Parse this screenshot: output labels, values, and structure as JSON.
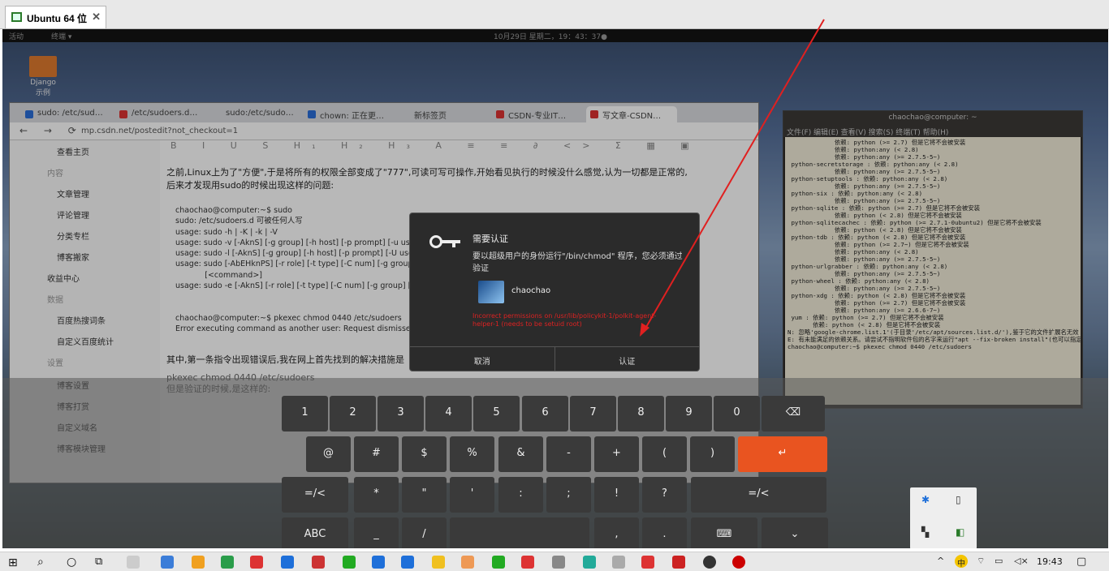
{
  "vm_tab": {
    "label": "Ubuntu 64 位",
    "close": "✕"
  },
  "topbar": {
    "activities": "活动",
    "terminal_menu": "终端 ▾",
    "datetime": "10月29日 星期二，19：43：37●"
  },
  "desktop": {
    "icon_label": "Django 示例"
  },
  "browser": {
    "tabs": [
      "sudo: /etc/sud…",
      "/etc/sudoers.d…",
      "sudo:/etc/sudo…",
      "chown: 正在更…",
      "新标签页",
      "CSDN-专业IT…",
      "写文章-CSDN…"
    ],
    "nav": "← → ⟳",
    "url": "mp.csdn.net/postedit?not_checkout=1",
    "sidebar": [
      "查看主页",
      "内容",
      "文章管理",
      "评论管理",
      "分类专栏",
      "博客搬家",
      "收益中心",
      "数据",
      "百度热搜词条",
      "自定义百度统计",
      "设置",
      "博客设置",
      "博客打赏",
      "自定义域名",
      "博客模块管理"
    ],
    "toolbar": "B I U S H₁ H₂ H₃ A ≡ ≡ ∂ <> Σ ▦ ▣ ⇥ ≡ ↶ ↷",
    "intro": "之前,Linux上为了\"方便\",于是将所有的权限全部变成了\"777\",可读可写可操作,开始看见执行的时候没什么感觉,认为一切都是正常的,后来才发现用sudo的时候出现这样的问题:",
    "code": "chaochao@computer:~$ sudo\nsudo: /etc/sudoers.d 可被任何人写\nusage: sudo -h | -K | -k | -V\nusage: sudo -v [-AknS] [-g group] [-h host] [-p prompt] [-u user]\nusage: sudo -l [-AknS] [-g group] [-h host] [-p prompt] [-U user]\nusage: sudo [-AbEHknPS] [-r role] [-t type] [-C num] [-g group]\n            [<command>]\nusage: sudo -e [-AknS] [-r role] [-t type] [-C num] [-g group] [-h h\n\n\nchaochao@computer:~$ pkexec chmod 0440 /etc/sudoers\nError executing command as another user: Request dismissed",
    "para2": "其中,第一条指令出现错误后,我在网上首先找到的解决措施是",
    "para3": "pkexec chmod 0440 /etc/sudoers\n但是验证的时候,是这样的:"
  },
  "terminal": {
    "title": "chaochao@computer: ~",
    "menu": "文件(F)  编辑(E)  查看(V)  搜索(S)  终端(T)  帮助(H)",
    "text": "             依赖: python (>= 2.7) 但是它将不会被安装\n             依赖: python:any (< 2.8)\n             依赖: python:any (>= 2.7.5-5~)\n python-secretstorage : 依赖: python:any (< 2.8)\n             依赖: python:any (>= 2.7.5-5~)\n python-setuptools : 依赖: python:any (< 2.8)\n             依赖: python:any (>= 2.7.5-5~)\n python-six : 依赖: python:any (< 2.8)\n             依赖: python:any (>= 2.7.5-5~)\n python-sqlite : 依赖: python (>= 2.7) 但是它将不会被安装\n             依赖: python (< 2.8) 但是它将不会被安装\n python-sqlitecachec : 依赖: python (>= 2.7.1-0ubuntu2) 但是它将不会被安装\n             依赖: python (< 2.8) 但是它将不会被安装\n python-tdb : 依赖: python (< 2.8) 但是它将不会被安装\n             依赖: python (>= 2.7~) 但是它将不会被安装\n             依赖: python:any (< 2.8)\n             依赖: python:any (>= 2.7.5-5~)\n python-urlgrabber : 依赖: python:any (< 2.8)\n             依赖: python:any (>= 2.7.5-5~)\n python-wheel : 依赖: python:any (< 2.8)\n             依赖: python:any (>= 2.7.5-5~)\n python-xdg : 依赖: python (< 2.8) 但是它将不会被安装\n             依赖: python (>= 2.7) 但是它将不会被安装\n             依赖: python:any (>= 2.6.6-7~)\n yum : 依赖: python (>= 2.7) 但是它将不会被安装\n       依赖: python (< 2.8) 但是它将不会被安装\nN: 忽略'google-chrome.list.1'(于目录'/etc/apt/sources.list.d/'),鉴于它的文件扩展名无效\nE: 有未能满足的依赖关系。请尝试不指明软件包的名字来运行\"apt --fix-broken install\"(也可以指定一个解决办法)。\nchaochao@computer:~$ pkexec chmod 0440 /etc/sudoers"
  },
  "auth_dialog": {
    "title": "需要认证",
    "message": "要以超级用户的身份运行\"/bin/chmod\" 程序，您必须通过验证",
    "user": "chaochao",
    "error": "Incorrect permissions on /usr/lib/policykit-1/polkit-agent-helper-1 (needs to be setuid root)",
    "cancel": "取消",
    "confirm": "认证"
  },
  "keyboard": {
    "row1": [
      "1",
      "2",
      "3",
      "4",
      "5",
      "6",
      "7",
      "8",
      "9",
      "0",
      "⌫"
    ],
    "row2": [
      "@",
      "#",
      "$",
      "%",
      "&",
      "-",
      "+",
      "(",
      ")",
      "↵"
    ],
    "row3": [
      "=/<",
      "*",
      "\"",
      "'",
      ":",
      ";",
      "!",
      "?",
      "=/<"
    ],
    "row4": [
      "ABC",
      "_",
      "/",
      ",",
      ".",
      "⌨",
      "⌄"
    ]
  },
  "tray_popup": [
    "bluetooth",
    "usb",
    "flag",
    "vm"
  ],
  "taskbar": {
    "clock": "19:43",
    "ime": "中",
    "sys_icons": "^  ⚡  ⌁  ▭  ◁×"
  },
  "colors": {
    "accent": "#e95420",
    "arrow": "#e02020"
  }
}
